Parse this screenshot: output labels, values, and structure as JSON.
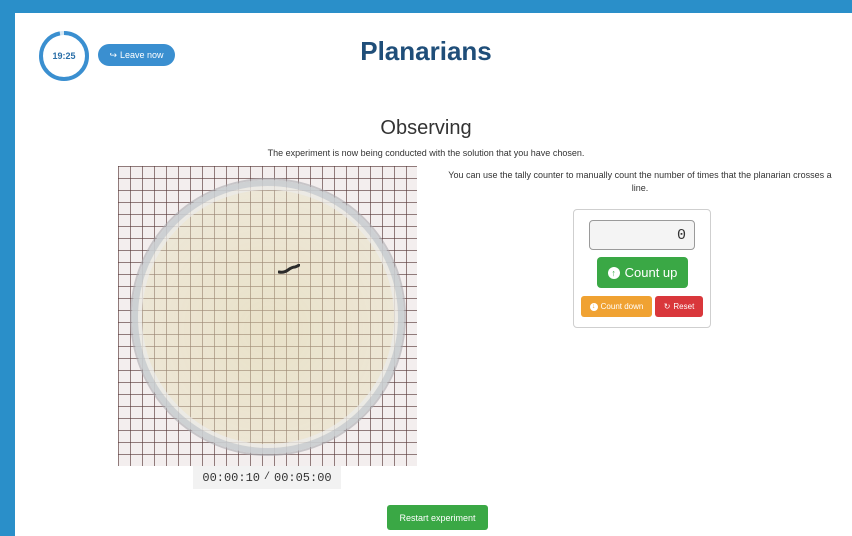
{
  "header": {
    "timer": "19:25",
    "timer_progress": 0.97,
    "leave_label": "Leave now",
    "title": "Planarians"
  },
  "main": {
    "section_title": "Observing",
    "subtitle": "The experiment is now being conducted with the solution that you have chosen.",
    "instructions": "You can use the tally counter to manually count the number of times that the planarian crosses a line.",
    "elapsed_time": "00:00:10",
    "time_separator": "/",
    "total_time": "00:05:00"
  },
  "counter": {
    "value": "0",
    "count_up_label": "Count up",
    "count_down_label": "Count down",
    "reset_label": "Reset"
  },
  "footer": {
    "restart_label": "Restart experiment"
  },
  "colors": {
    "background": "#2a8fc9",
    "title": "#1f4e79",
    "success": "#3aa845",
    "warning": "#f0a232",
    "danger": "#d9373b",
    "primary": "#3a8fd0"
  },
  "icons": {
    "leave": "sign-out-icon",
    "count_up": "arrow-up-circle-icon",
    "count_down": "arrow-down-circle-icon",
    "reset": "refresh-icon"
  }
}
